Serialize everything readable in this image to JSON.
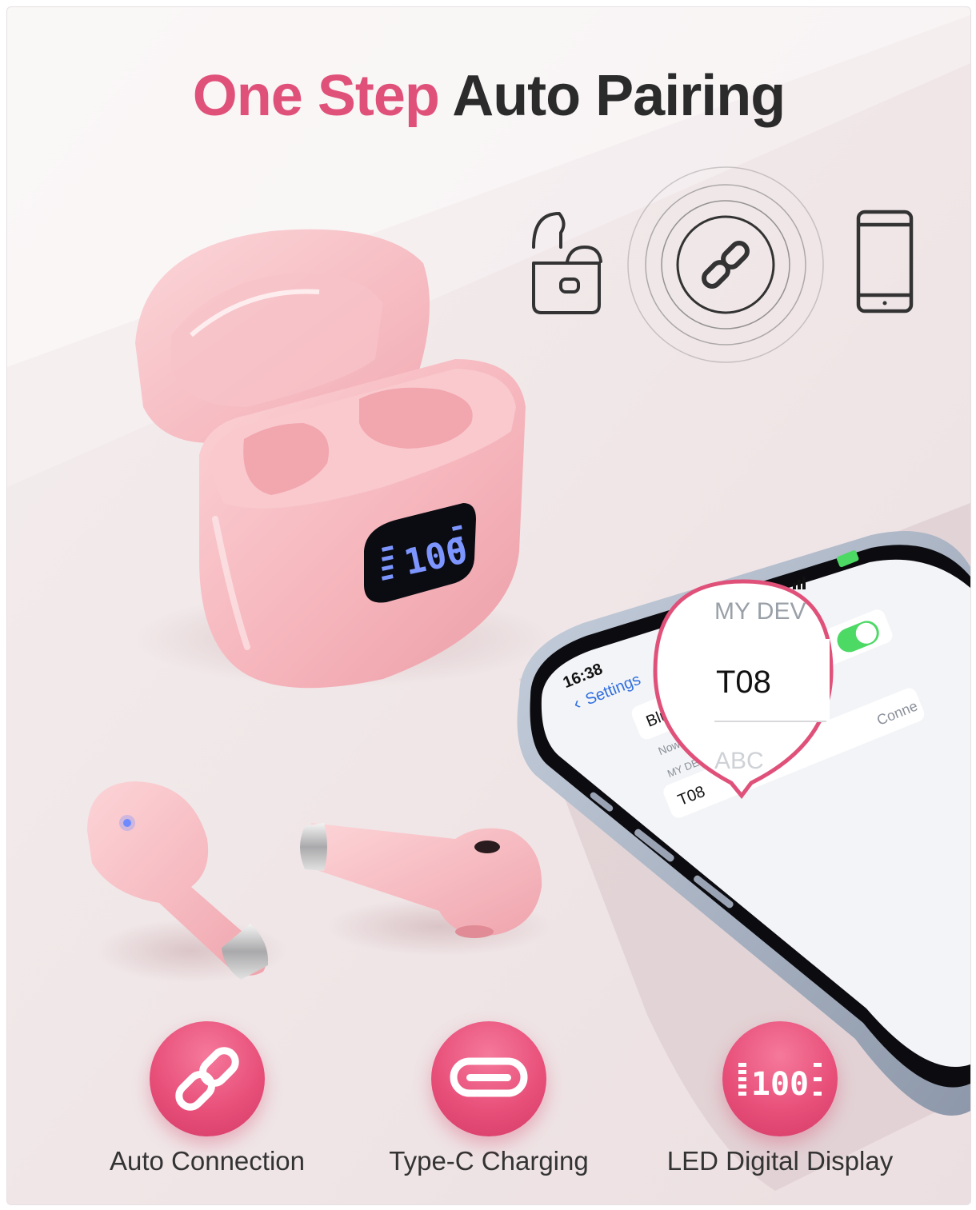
{
  "headline": {
    "accent": "One Step",
    "rest": "Auto Pairing"
  },
  "colors": {
    "accent": "#e0517a",
    "headline_dark": "#2b2b2b",
    "product_pink": "#f4b6bd",
    "led_blue": "#6d8cff",
    "toggle_green": "#4cd964"
  },
  "pairing_icons": [
    "earbuds-case-icon",
    "link-icon",
    "smartphone-icon"
  ],
  "case_display": {
    "value": "100"
  },
  "phone": {
    "time": "16:38",
    "back_label": "Settings",
    "row_label": "Blue",
    "section_header": "MY DEV",
    "note": "Now d",
    "device_name": "T08",
    "status": "Conne",
    "magnifier": {
      "header": "MY DEV",
      "device": "T08",
      "footer": "ABC"
    }
  },
  "features": [
    {
      "icon": "link-icon",
      "label": "Auto Connection"
    },
    {
      "icon": "usb-c-icon",
      "label": "Type-C Charging"
    },
    {
      "icon": "led-display-icon",
      "label": "LED Digital Display"
    }
  ]
}
